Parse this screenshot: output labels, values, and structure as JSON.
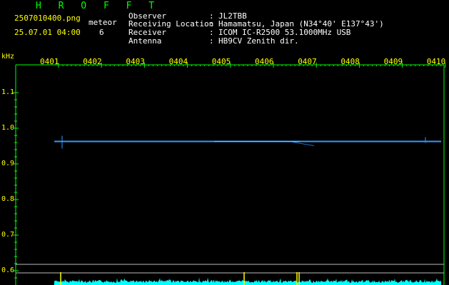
{
  "app": {
    "title": "H R O F F T"
  },
  "file": {
    "name": "2507010400.png",
    "datetime": "25.07.01 04:00",
    "meteor_label": "meteor",
    "meteor_count": "6"
  },
  "station": [
    {
      "key": "Observer",
      "value": "JL2TBB"
    },
    {
      "key": "Receiving Location",
      "value": "Hamamatsu, Japan (N34°40' E137°43')"
    },
    {
      "key": "Receiver",
      "value": "ICOM IC-R2500 53.1000MHz USB"
    },
    {
      "key": "Antenna",
      "value": "HB9CV Zenith dir."
    }
  ],
  "colors": {
    "background": "#000000",
    "title": "#00ff00",
    "labels": "#ffff00",
    "axis": "#00ff00",
    "signal": "#00ffff",
    "carrier": "#3399ff",
    "spike": "#ffff00"
  },
  "chart_data": {
    "type": "spectrogram",
    "ylabel": "kHz",
    "x_ticks": [
      "0401",
      "0402",
      "0403",
      "0404",
      "0405",
      "0406",
      "0407",
      "0408",
      "0409",
      "0410"
    ],
    "y_ticks": [
      "1.1",
      "1.0",
      "0.9",
      "0.8",
      "0.7",
      "0.6"
    ],
    "ylim": [
      0.6,
      1.1
    ],
    "carrier_khz": 0.963
  }
}
